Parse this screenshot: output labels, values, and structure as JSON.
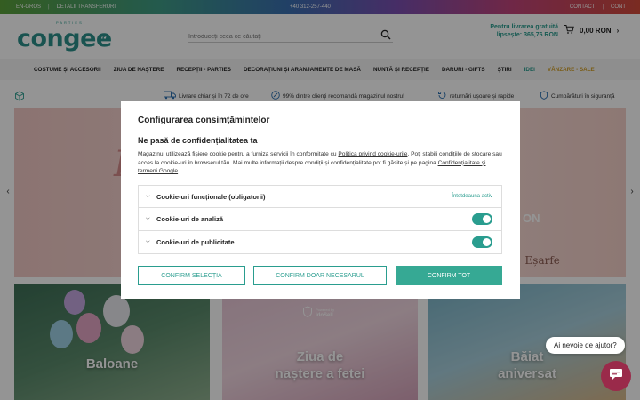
{
  "topbar": {
    "left_links": [
      "EN-GROS",
      "DETALII TRANSFERURI"
    ],
    "phone": "+40 312-257-440",
    "right_links": [
      "CONTACT",
      "CONT"
    ]
  },
  "header": {
    "logo_small": "PARTIES",
    "logo_text": "congee",
    "logo_suffix": ".ro",
    "search_placeholder": "Introduceți ceea ce căutați",
    "shipping_line1": "Pentru livrarea gratuită",
    "shipping_line2": "lipsește: 365,76 RON",
    "cart_total": "0,00 RON"
  },
  "nav": {
    "items": [
      "COSTUME ȘI ACCESORII",
      "ZIUA DE NAȘTERE",
      "RECEPȚII - PARTIES",
      "DECORAȚIUNI ȘI ARANJAMENTE DE MASĂ",
      "NUNTĂ ȘI RECEPȚIE",
      "DARURI - GIFTS",
      "ȘTIRI",
      "IDEI",
      "VÂNZARE - SALE"
    ]
  },
  "benefits": [
    "Livrare chiar și în 72 de ore",
    "99% dintre clienți recomandă magazinul nostru!",
    "returnări ușoare și rapide",
    "Cumpărături în siguranță"
  ],
  "hero": {
    "partial_b": "B",
    "partial_on": "ON",
    "partial_scarves": "l • Eșarfe"
  },
  "tiles": [
    {
      "title": "Baloane"
    },
    {
      "title_line1": "Ziua de",
      "title_line2": "naștere a fetei"
    },
    {
      "title_line1": "Băiat",
      "title_line2": "aniversat"
    }
  ],
  "idosell": {
    "powered": "Powered by",
    "brand": "IdoSell"
  },
  "help_bubble": "Ai nevoie de ajutor?",
  "consent": {
    "title": "Configurarea consimțămintelor",
    "subtitle": "Ne pasă de confidențialitatea ta",
    "text_part1": "Magazinul utilizează fișiere cookie pentru a furniza servicii în conformitate cu ",
    "link1": "Politica privind cookie-urile",
    "text_part2": ". Poți stabili condițiile de stocare sau acces la cookie-uri în browserul tău. Mai multe informații despre condiții și confidențialitate pot fi găsite și pe pagina ",
    "link2": "Confidențialitate și termeni Google",
    "text_part3": ".",
    "rows": [
      {
        "label": "Cookie-uri funcționale (obligatorii)",
        "status": "Întotdeauna activ"
      },
      {
        "label": "Cookie-uri de analiză"
      },
      {
        "label": "Cookie-uri de publicitate"
      }
    ],
    "btn_selection": "CONFIRM SELECȚIA",
    "btn_necessary": "CONFIRM DOAR NECESARUL",
    "btn_all": "CONFIRM TOT"
  }
}
